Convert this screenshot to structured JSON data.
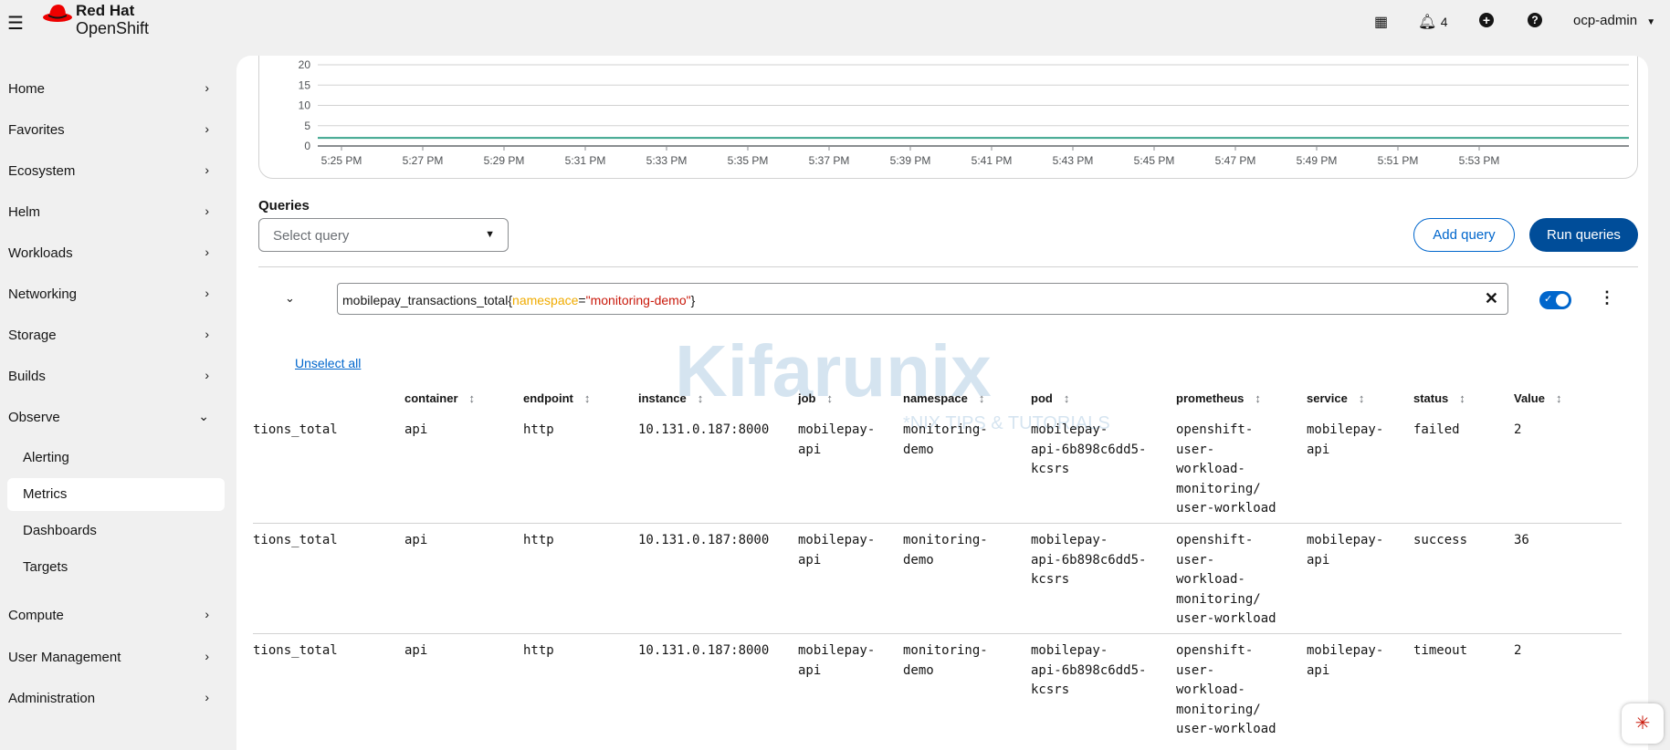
{
  "header": {
    "brand_top": "Red Hat",
    "brand_bottom": "OpenShift",
    "notifications": "4",
    "user": "ocp-admin"
  },
  "sidebar": {
    "items": [
      "Home",
      "Favorites",
      "Ecosystem",
      "Helm",
      "Workloads",
      "Networking",
      "Storage",
      "Builds",
      "Observe"
    ],
    "observe_sub": [
      "Alerting",
      "Metrics",
      "Dashboards",
      "Targets"
    ],
    "items_after": [
      "Compute",
      "User Management",
      "Administration"
    ]
  },
  "chart_data": {
    "type": "line",
    "y_ticks": [
      "20",
      "15",
      "10",
      "5",
      "0"
    ],
    "ylim": [
      0,
      20
    ],
    "x_ticks": [
      "5:25 PM",
      "5:27 PM",
      "5:29 PM",
      "5:31 PM",
      "5:33 PM",
      "5:35 PM",
      "5:37 PM",
      "5:39 PM",
      "5:41 PM",
      "5:43 PM",
      "5:45 PM",
      "5:47 PM",
      "5:49 PM",
      "5:51 PM",
      "5:53 PM"
    ],
    "series": [
      {
        "name": "timeout",
        "value": 2,
        "color": "#3ca58d"
      }
    ]
  },
  "queries": {
    "label": "Queries",
    "select_placeholder": "Select query",
    "add": "Add query",
    "run": "Run queries",
    "expr_metric": "mobilepay_transactions_total",
    "expr_open": "{",
    "expr_label": "namespace",
    "expr_eq": "=",
    "expr_value": "\"monitoring-demo\"",
    "expr_close": "}"
  },
  "table": {
    "unselect": "Unselect all",
    "headers": [
      "container",
      "endpoint",
      "instance",
      "job",
      "namespace",
      "pod",
      "prometheus",
      "service",
      "status",
      "Value"
    ],
    "rows": [
      [
        "tions_total",
        "api",
        "http",
        "10.131.0.187:8000",
        "mobilepay-\napi",
        "monitoring-\ndemo",
        "mobilepay-\napi-6b898c6dd5-\nkcsrs",
        "openshift-\nuser-\nworkload-\nmonitoring/\nuser-workload",
        "mobilepay-\napi",
        "failed",
        "2"
      ],
      [
        "tions_total",
        "api",
        "http",
        "10.131.0.187:8000",
        "mobilepay-\napi",
        "monitoring-\ndemo",
        "mobilepay-\napi-6b898c6dd5-\nkcsrs",
        "openshift-\nuser-\nworkload-\nmonitoring/\nuser-workload",
        "mobilepay-\napi",
        "success",
        "36"
      ],
      [
        "tions_total",
        "api",
        "http",
        "10.131.0.187:8000",
        "mobilepay-\napi",
        "monitoring-\ndemo",
        "mobilepay-\napi-6b898c6dd5-\nkcsrs",
        "openshift-\nuser-\nworkload-\nmonitoring/\nuser-workload",
        "mobilepay-\napi",
        "timeout",
        "2"
      ]
    ]
  },
  "watermark": {
    "text": "Kifarunix",
    "tagline": "*NIX TIPS & TUTORIALS"
  }
}
